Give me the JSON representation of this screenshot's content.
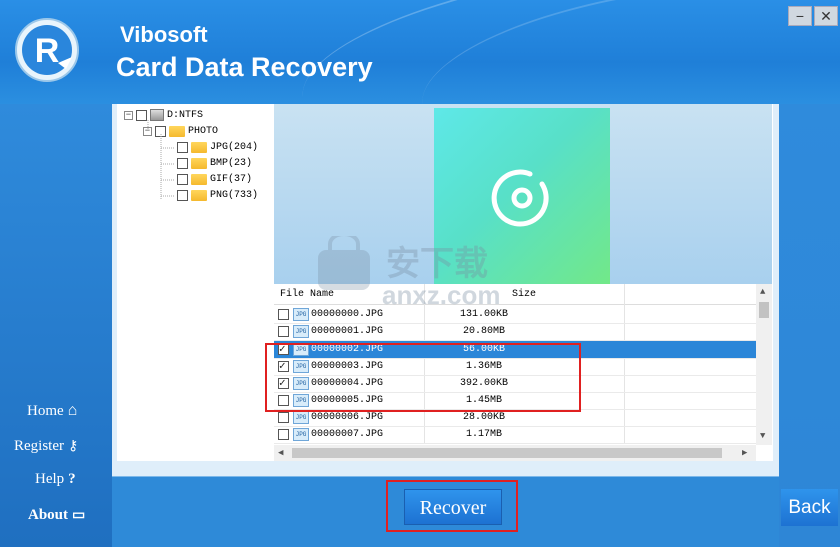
{
  "app": {
    "brand": "Vibosoft",
    "product": "Card Data Recovery",
    "window_controls": {
      "minimize": "−",
      "close": "✕"
    }
  },
  "nav": [
    {
      "label": "Home",
      "icon": "home-icon",
      "glyph": "⌂"
    },
    {
      "label": "Register",
      "icon": "key-icon",
      "glyph": "⚷"
    },
    {
      "label": "Help",
      "icon": "question-icon",
      "glyph": "?"
    },
    {
      "label": "About",
      "icon": "monitor-icon",
      "glyph": "▭"
    }
  ],
  "tree": {
    "drive": "D:NTFS",
    "folder": "PHOTO",
    "children": [
      {
        "label": "JPG(204)"
      },
      {
        "label": "BMP(23)"
      },
      {
        "label": "GIF(37)"
      },
      {
        "label": "PNG(733)"
      }
    ]
  },
  "filelist": {
    "col_name": "File Name",
    "col_size": "Size",
    "rows": [
      {
        "name": "00000000.JPG",
        "size": "131.00KB",
        "checked": false,
        "selected": false
      },
      {
        "name": "00000001.JPG",
        "size": "20.80MB",
        "checked": false,
        "selected": false
      },
      {
        "name": "00000002.JPG",
        "size": "56.00KB",
        "checked": true,
        "selected": true
      },
      {
        "name": "00000003.JPG",
        "size": "1.36MB",
        "checked": true,
        "selected": false
      },
      {
        "name": "00000004.JPG",
        "size": "392.00KB",
        "checked": true,
        "selected": false
      },
      {
        "name": "00000005.JPG",
        "size": "1.45MB",
        "checked": false,
        "selected": false
      },
      {
        "name": "00000006.JPG",
        "size": "28.00KB",
        "checked": false,
        "selected": false
      },
      {
        "name": "00000007.JPG",
        "size": "1.17MB",
        "checked": false,
        "selected": false
      }
    ],
    "file_badge": "JPG"
  },
  "buttons": {
    "recover": "Recover",
    "back": "Back"
  },
  "watermark": {
    "main": "安下载",
    "sub": "anxz.com"
  },
  "colors": {
    "accent": "#2b86d8",
    "highlight": "#e02020",
    "thumb_from": "#5ee8e8",
    "thumb_to": "#72e888"
  }
}
